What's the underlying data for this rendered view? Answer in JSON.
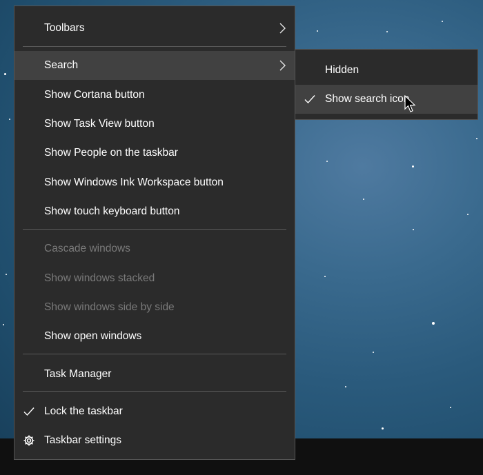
{
  "context_menu": {
    "items": [
      {
        "label": "Toolbars",
        "has_submenu": true
      },
      {
        "label": "Search",
        "has_submenu": true,
        "highlighted": true
      },
      {
        "label": "Show Cortana button"
      },
      {
        "label": "Show Task View button"
      },
      {
        "label": "Show People on the taskbar"
      },
      {
        "label": "Show Windows Ink Workspace button"
      },
      {
        "label": "Show touch keyboard button"
      },
      {
        "label": "Cascade windows",
        "disabled": true
      },
      {
        "label": "Show windows stacked",
        "disabled": true
      },
      {
        "label": "Show windows side by side",
        "disabled": true
      },
      {
        "label": "Show open windows"
      },
      {
        "label": "Task Manager"
      },
      {
        "label": "Lock the taskbar",
        "checked": true,
        "icon": "checkmark-icon"
      },
      {
        "label": "Taskbar settings",
        "icon": "gear-icon"
      }
    ]
  },
  "search_submenu": {
    "items": [
      {
        "label": "Hidden"
      },
      {
        "label": "Show search icon",
        "checked": true,
        "icon": "checkmark-icon",
        "highlighted": true
      }
    ]
  },
  "colors": {
    "menu_bg": "#2b2b2b",
    "menu_highlight": "#414141",
    "disabled_text": "#7a7a7a",
    "taskbar": "#101010"
  }
}
